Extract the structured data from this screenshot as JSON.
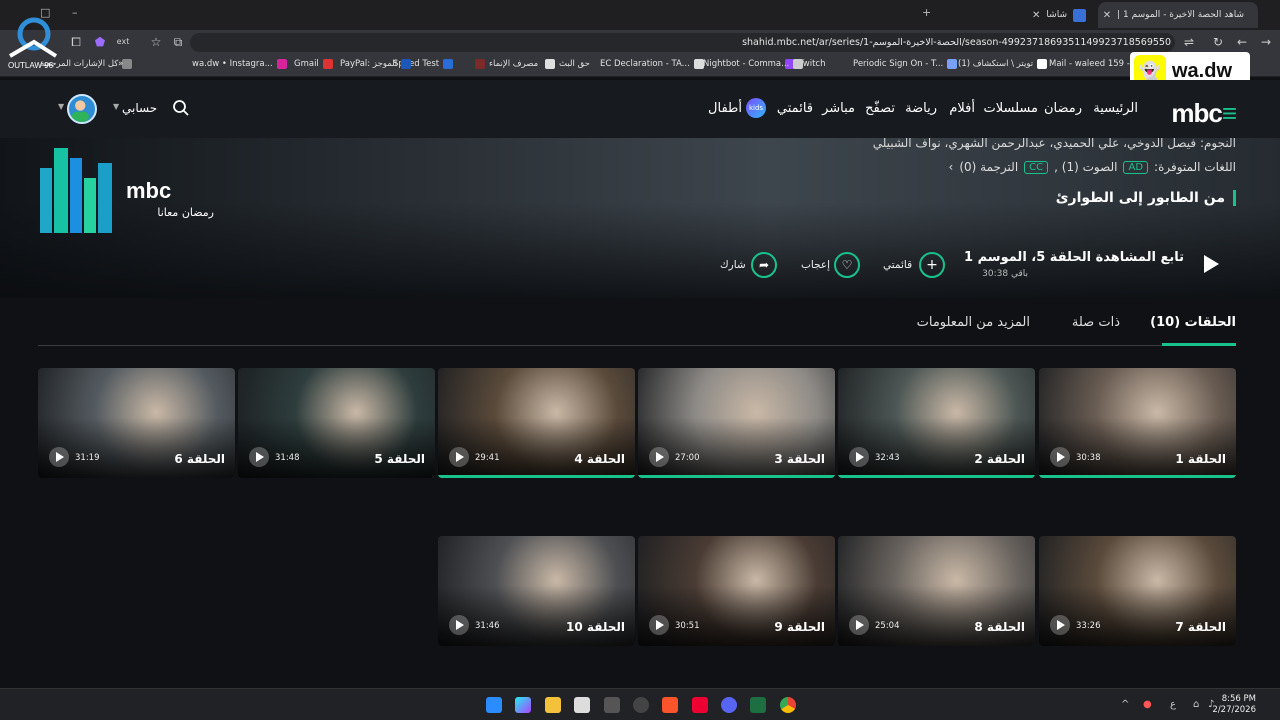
{
  "browser": {
    "tabs": [
      {
        "title": "شاهد الحصة الاخيرة - الموسم 1 |",
        "active": true
      },
      {
        "title": "شاشا",
        "active": false
      }
    ],
    "url": "shahid.mbc.net/ar/series/الحصة-الاخيرة-الموسم-1/season-499237186935114992371856955​0",
    "bookmarks": [
      "Mail - waleed 159 -...",
      "(1) تويتر \\ استكشاف",
      "Periodic Sign On - T...",
      "Twitch",
      "Nightbot - Comma...",
      "EC Declaration - TA...",
      "حق البث",
      "مصرف الإنماء",
      "Speed Test",
      "PayPal: الموجز",
      "Gmail",
      "wa.dw • Instagra...",
      "كل الإشارات المرجعية"
    ]
  },
  "watermark": {
    "snap_handle": "wa.dw",
    "logo_text": "OUTLAW 96"
  },
  "site": {
    "brand": "mbc",
    "nav": [
      "الرئيسية",
      "رمضان",
      "مسلسلات",
      "أفلام",
      "رياضة",
      "تصفّح",
      "مباشر",
      "قائمتي",
      "أطفال"
    ],
    "kids_badge": "kids",
    "account_label": "حسابي"
  },
  "hero": {
    "stars": "النجوم: فيصل الدوخي، علي الحميدي، عبدالرحمن الشهري، نواف الشبيلي",
    "languages_label": "اللغات المتوفرة:",
    "ad_badge": "AD",
    "audio": "الصوت (1) ,",
    "cc_badge": "CC",
    "subs": "الترجمة (0)",
    "tagline": "من الطابور إلى الطوارئ",
    "ramadan_logo": "mbc",
    "ramadan_sub": "رمضان معانا",
    "continue_label": "تابع المشاهدة الحلقة 5، الموسم 1",
    "remaining": "30:38 باقي",
    "my_list": "قائمتي",
    "like": "إعجاب",
    "share": "شارك"
  },
  "content_tabs": {
    "episodes": "الحلقات (10)",
    "related": "ذات صلة",
    "more_info": "المزيد من المعلومات"
  },
  "episodes": [
    {
      "title": "الحلقة 1",
      "duration": "30:38",
      "progress": 1.0,
      "color": "#6a5d53"
    },
    {
      "title": "الحلقة 2",
      "duration": "32:43",
      "progress": 1.0,
      "color": "#4c5654"
    },
    {
      "title": "الحلقة 3",
      "duration": "27:00",
      "progress": 1.0,
      "color": "#8d8a86"
    },
    {
      "title": "الحلقة 4",
      "duration": "29:41",
      "progress": 1.0,
      "color": "#5a4a3a"
    },
    {
      "title": "الحلقة 5",
      "duration": "31:48",
      "progress": 0.0,
      "color": "#2e3d3d"
    },
    {
      "title": "الحلقة 6",
      "duration": "31:19",
      "progress": 0.0,
      "color": "#545b60"
    },
    {
      "title": "الحلقة 7",
      "duration": "33:26",
      "progress": 0.0,
      "color": "#5a4a3b"
    },
    {
      "title": "الحلقة 8",
      "duration": "25:04",
      "progress": 0.0,
      "color": "#6b6560"
    },
    {
      "title": "الحلقة 9",
      "duration": "30:51",
      "progress": 0.0,
      "color": "#4a3c34"
    },
    {
      "title": "الحلقة 10",
      "duration": "31:46",
      "progress": 0.0,
      "color": "#4d4f52"
    }
  ],
  "taskbar": {
    "time": "8:56 PM",
    "date": "2/27/2026",
    "lang": "ع"
  },
  "colors": {
    "accent": "#19c28b"
  }
}
